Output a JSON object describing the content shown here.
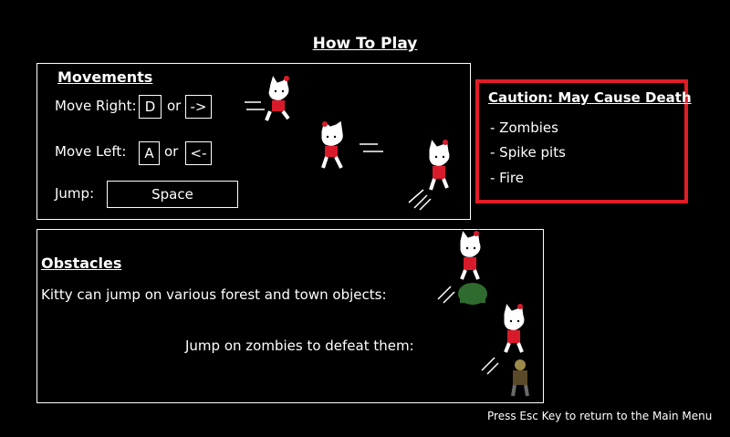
{
  "title": "How To Play",
  "movements": {
    "heading": "Movements",
    "right_label": "Move Right:",
    "right_key": "D",
    "right_or": "or",
    "right_arrow": "->",
    "left_label": "Move Left:",
    "left_key": "A",
    "left_or": "or",
    "left_arrow": "<-",
    "jump_label": "Jump:",
    "jump_key": "Space"
  },
  "caution": {
    "heading": "Caution: May Cause Death",
    "items": [
      "- Zombies",
      "- Spike pits",
      "- Fire"
    ]
  },
  "obstacles": {
    "heading": "Obstacles",
    "line1": "Kitty can jump on various  forest and town objects:",
    "line2": "Jump on zombies to defeat them:"
  },
  "footer": "Press Esc Key to return to the Main Menu",
  "colors": {
    "caution_border": "#e11d25",
    "bow": "#d81b2a",
    "bush": "#2f6b2e"
  }
}
